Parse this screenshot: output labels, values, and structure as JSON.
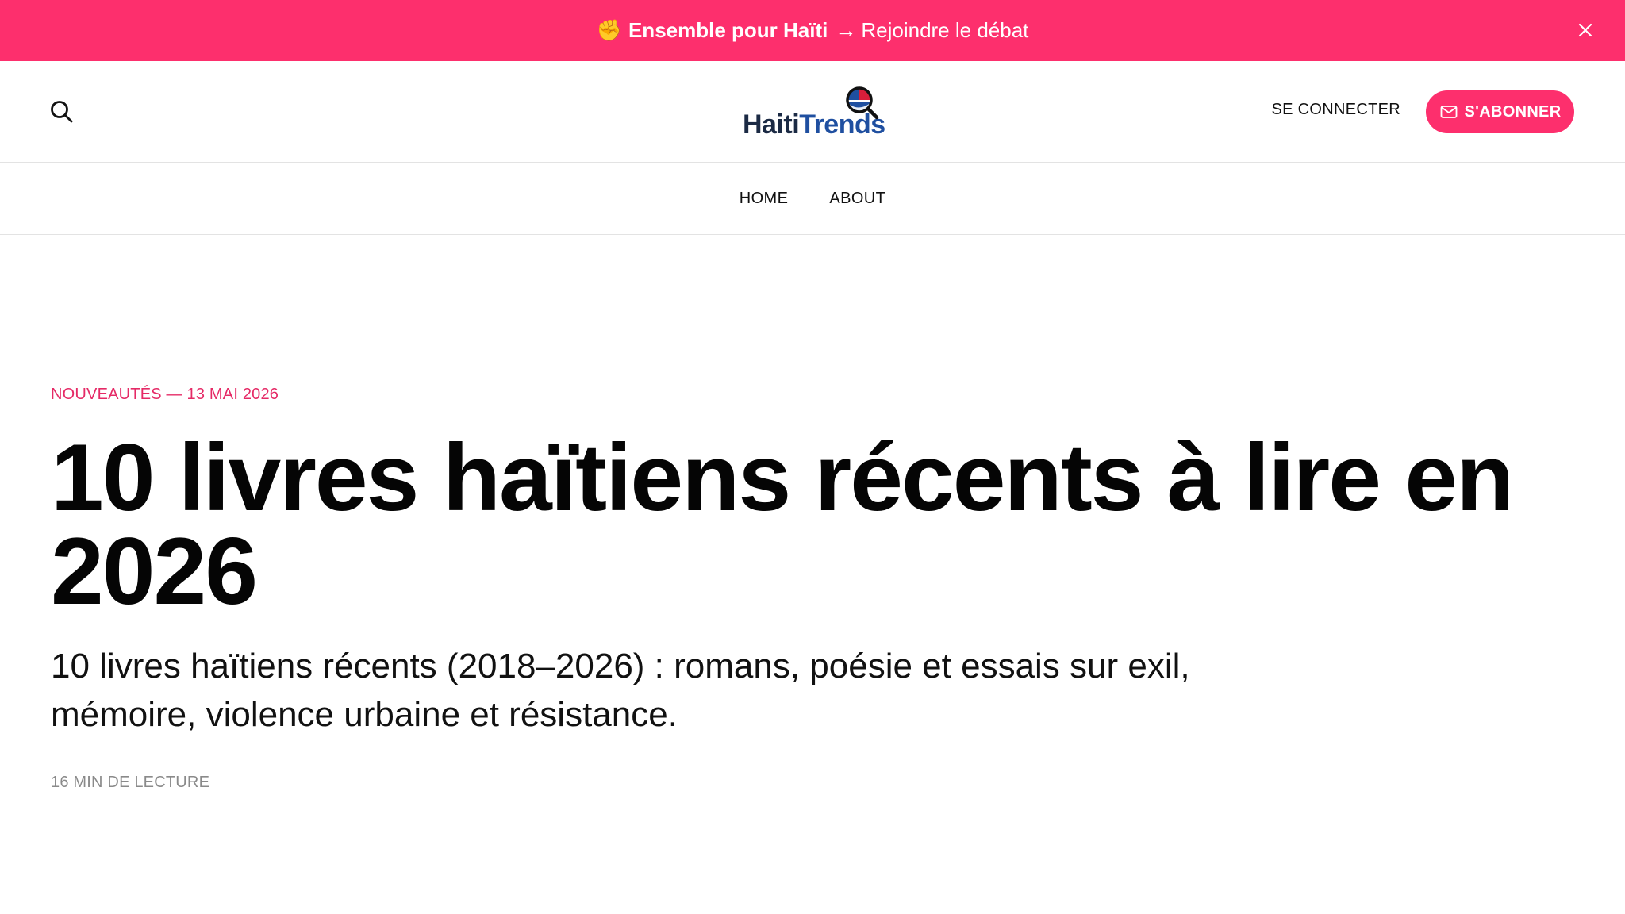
{
  "banner": {
    "icon": "raised-fist-emoji",
    "icon_glyph": "✊",
    "bold_text": "Ensemble pour Haïti",
    "arrow": "→",
    "link_text": "Rejoindre le débat",
    "background": "#fd2f6d"
  },
  "header": {
    "logo_part1": "Haiti",
    "logo_part2": "Trends",
    "signin_label": "SE CONNECTER",
    "subscribe_label": "S'ABONNER",
    "accent": "#fd2f6d"
  },
  "nav": {
    "items": [
      {
        "label": "HOME"
      },
      {
        "label": "ABOUT"
      }
    ]
  },
  "article": {
    "kicker": "NOUVEAUTÉS — 13 MAI 2026",
    "title": "10 livres haïtiens récents à lire en 2026",
    "excerpt": "10 livres haïtiens récents (2018–2026) : romans, poésie et essais sur exil, mémoire, violence urbaine et résistance.",
    "reading_time": "16 MIN DE LECTURE",
    "kicker_color": "#e52a66"
  }
}
